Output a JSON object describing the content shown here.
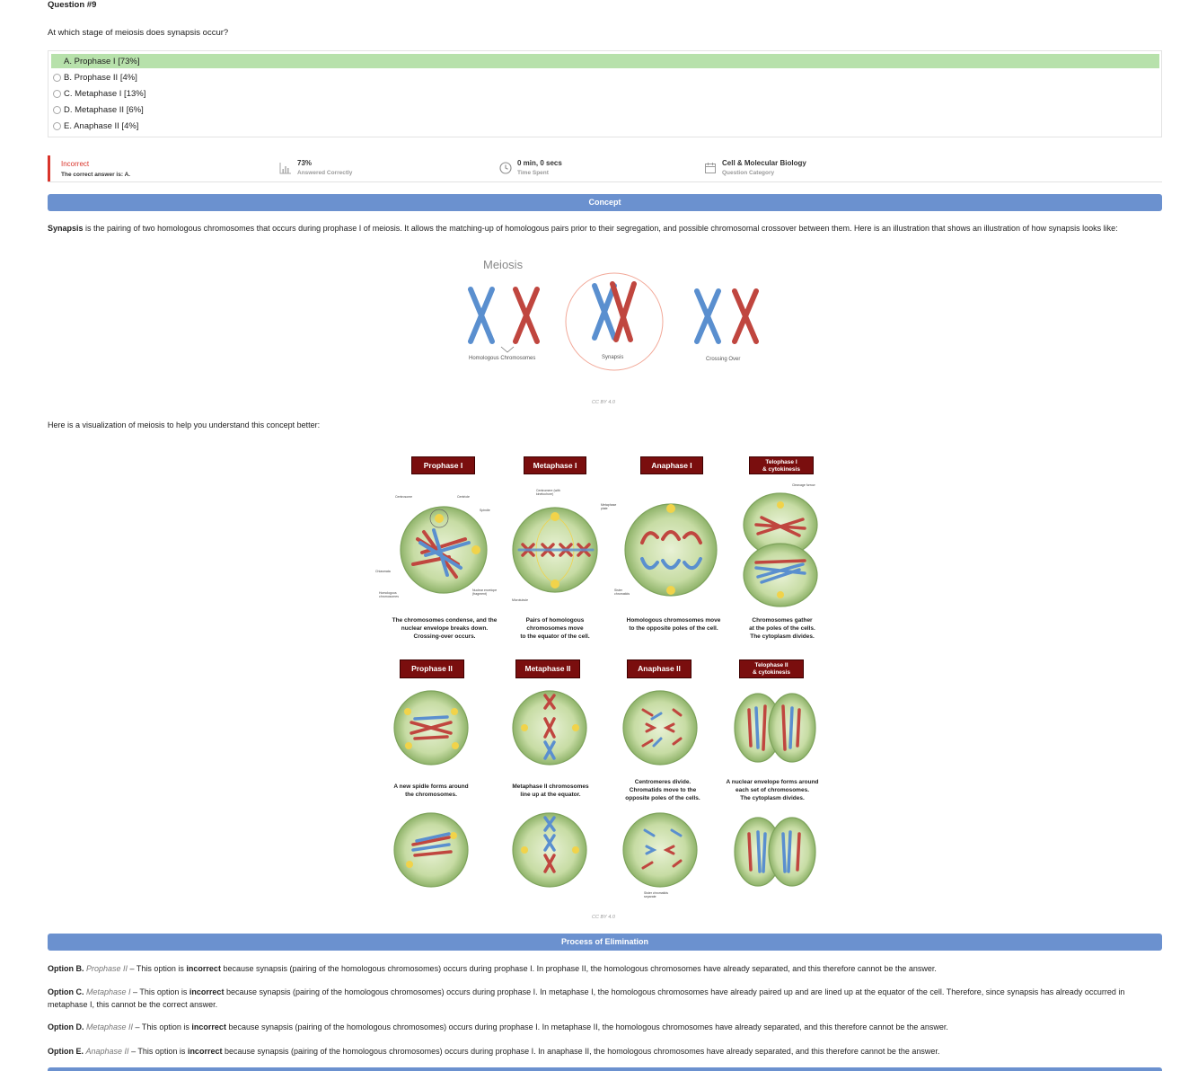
{
  "question": {
    "number": "Question #9",
    "stem": "At which stage of meiosis does synapsis occur?",
    "options": [
      {
        "label": "A. Prophase I [73%]",
        "correct": true
      },
      {
        "label": "B. Prophase II [4%]",
        "correct": false
      },
      {
        "label": "C. Metaphase I [13%]",
        "correct": false
      },
      {
        "label": "D. Metaphase II [6%]",
        "correct": false
      },
      {
        "label": "E. Anaphase II [4%]",
        "correct": false
      }
    ]
  },
  "result": {
    "status": "Incorrect",
    "answer_text": "The correct answer is: A.",
    "status_color": "#d9342b",
    "percent_value": "73%",
    "percent_label": "Answered Correctly",
    "time_value": "0 min, 0 secs",
    "time_label": "Time Spent",
    "category_value": "Cell & Molecular Biology",
    "category_label": "Question Category"
  },
  "concept": {
    "header": "Concept",
    "term": "Synapsis",
    "paragraph": " is the pairing of two homologous chromosomes that occurs during prophase I of meiosis. It allows the matching-up of homologous pairs prior to their segregation, and possible chromosomal crossover between them. Here is an illustration that shows an illustration of how synapsis looks like:",
    "figure1": {
      "title": "Meiosis",
      "labels": [
        "Homologous Chromosomes",
        "Synapsis",
        "Crossing Over"
      ],
      "credit": "CC BY 4.0"
    },
    "viz_intro": "Here is a visualization of meiosis to help you understand this concept better:",
    "figure2": {
      "phases_row1": [
        "Prophase I",
        "Metaphase I",
        "Anaphase I",
        "Telophase I\n& cytokinesis"
      ],
      "captions_row1": [
        "The chromosomes condense, and the\nnuclear envelope breaks down.\nCrossing-over occurs.",
        "Pairs of homologous\nchromosomes move\nto the equator of the cell.",
        "Homologous chromosomes move\nto the opposite poles of the cell.",
        "Chromosomes gather\nat the poles of the cells.\nThe cytoplasm divides."
      ],
      "phases_row2": [
        "Prophase II",
        "Metaphase II",
        "Anaphase II",
        "Telophase II\n& cytokinesis"
      ],
      "captions_row2": [
        "A new spidle forms around\nthe chromosomes.",
        "Metaphase II chromosomes\nline up at the equator.",
        "Centromeres divide.\nChromatids move to the\nopposite poles of the cells.",
        "A nuclear envelope forms around\neach set of chromosomes.\nThe cytoplasm divides."
      ],
      "small_labels": [
        "Centrosome",
        "Centriole",
        "Spindle",
        "Chiasmata",
        "Homologous chromosomes",
        "Nuclear envelope (fragment)",
        "Centromere (with kinetochore)",
        "Metaphase plate",
        "Microtubule",
        "Sister chromatids",
        "Cleavage furrow",
        "Sister chromatids separate"
      ],
      "credit": "CC BY 4.0"
    }
  },
  "elimination": {
    "header": "Process of Elimination",
    "items": [
      {
        "opt": "Option B.",
        "name": "Prophase II",
        "a": " – This option is ",
        "b": "incorrect",
        "c": " because synapsis (pairing of the homologous chromosomes) occurs during prophase I. In prophase II, the homologous chromosomes have already separated, and this therefore cannot be the answer."
      },
      {
        "opt": "Option C.",
        "name": "Metaphase I",
        "a": " – This option is ",
        "b": "incorrect",
        "c": " because synapsis (pairing of the homologous chromosomes) occurs during prophase I. In metaphase I, the homologous chromosomes have already paired up and are lined up at the equator of the cell. Therefore, since synapsis has already occurred in metaphase I, this cannot be the correct answer."
      },
      {
        "opt": "Option D.",
        "name": "Metaphase II",
        "a": " – This option is ",
        "b": "incorrect",
        "c": " because synapsis (pairing of the homologous chromosomes) occurs during prophase I. In metaphase II, the homologous chromosomes have already separated, and this therefore cannot be the answer."
      },
      {
        "opt": "Option E.",
        "name": "Anaphase II",
        "a": " – This option is ",
        "b": "incorrect",
        "c": " because synapsis (pairing of the homologous chromosomes) occurs during prophase I. In anaphase II, the homologous chromosomes have already separated, and this therefore cannot be the answer."
      }
    ]
  },
  "colors": {
    "correct_bg": "#b7e1ab",
    "header_bar": "#6b91cf",
    "chromosome_blue": "#5a8fcf",
    "chromosome_red": "#c0463f",
    "phase_tag": "#7a0e0e"
  }
}
